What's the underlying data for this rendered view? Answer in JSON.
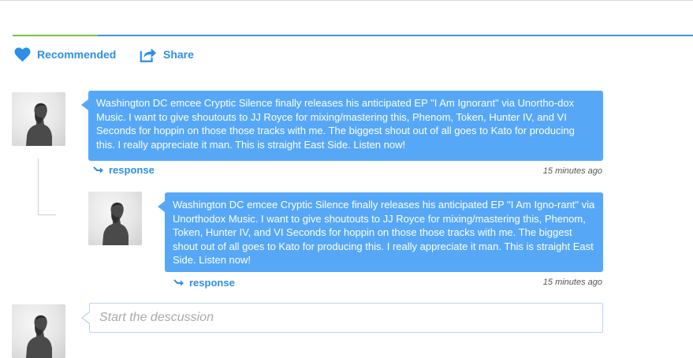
{
  "toolbar": {
    "progress_fraction": 0.125,
    "progress_colors": {
      "done": "#7ac143",
      "rest": "#3d95e6"
    },
    "recommended_label": "Recommended",
    "share_label": "Share",
    "recommended_icon": "heart-icon",
    "share_icon": "share-icon"
  },
  "comments": [
    {
      "text": "Washington DC emcee Cryptic Silence finally releases his anticipated EP \"I Am Ignorant\" via Unortho-dox Music. I want to give shoutouts to JJ Royce for mixing/mastering this, Phenom, Token, Hunter IV, and VI Seconds for hoppin on those those tracks with me. The biggest shout out of all goes to Kato for producing this. I really appreciate it man. This is straight East Side. Listen now!",
      "response_label": "response",
      "timestamp": "15 minutes ago"
    },
    {
      "text": "Washington DC emcee Cryptic Silence finally releases his anticipated EP \"I Am Igno-rant\" via Unorthodox Music. I want to give shoutouts to JJ Royce for mixing/mastering this, Phenom, Token, Hunter IV, and VI Seconds for hoppin on those those tracks with me. The biggest shout out of all goes to Kato for producing this. I really appreciate it man. This is straight East Side. Listen now!",
      "response_label": "response",
      "timestamp": "15 minutes ago"
    }
  ],
  "composer": {
    "placeholder": "Start the descussion",
    "value": ""
  },
  "colors": {
    "accent": "#2b8fe8",
    "bubble": "#56a8f7"
  }
}
